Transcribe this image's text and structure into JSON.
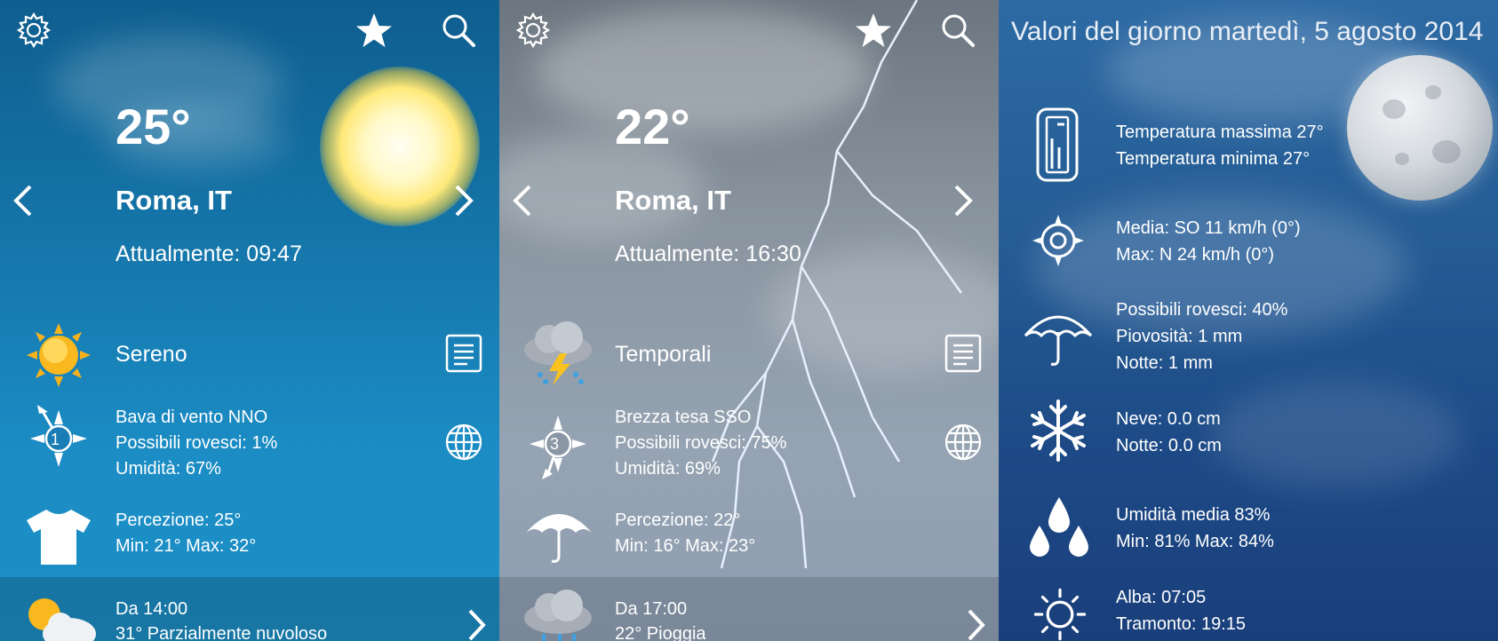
{
  "screen1": {
    "temperature": "25°",
    "city": "Roma, IT",
    "current_time": "Attualmente: 09:47",
    "condition": "Sereno",
    "wind_lines": [
      "Bava di vento NNO",
      "Possibili rovesci: 1%",
      "Umidità: 67%"
    ],
    "wind_force": "1",
    "feel_lines": [
      "Percezione: 25°",
      "Min: 21° Max: 32°"
    ],
    "forecast_lines": [
      "Da 14:00",
      "31° Parzialmente nuvoloso"
    ]
  },
  "screen2": {
    "temperature": "22°",
    "city": "Roma, IT",
    "current_time": "Attualmente: 16:30",
    "condition": "Temporali",
    "wind_lines": [
      "Brezza tesa SSO",
      "Possibili rovesci: 75%",
      "Umidità: 69%"
    ],
    "wind_force": "3",
    "feel_lines": [
      "Percezione: 22°",
      "Min: 16° Max: 23°"
    ],
    "forecast_lines": [
      "Da 17:00",
      "22° Pioggia"
    ]
  },
  "screen3": {
    "title": "Valori del giorno martedì, 5 agosto 2014",
    "temperature_lines": [
      "Temperatura massima 27°",
      "Temperatura minima 27°"
    ],
    "wind_lines": [
      "Media: SO 11 km/h (0°)",
      "Max: N 24 km/h (0°)"
    ],
    "rain_lines": [
      "Possibili rovesci: 40%",
      "Piovosità: 1 mm",
      "Notte: 1 mm"
    ],
    "snow_lines": [
      "Neve: 0.0 cm",
      "Notte: 0.0 cm"
    ],
    "humidity_lines": [
      "Umidità media 83%",
      "Min: 81% Max: 84%"
    ],
    "sun_lines": [
      "Alba: 07:05",
      "Tramonto: 19:15"
    ]
  },
  "icons": {
    "settings": "gear-icon",
    "favorite": "star-icon",
    "search": "search-icon",
    "prev": "chevron-left-icon",
    "next": "chevron-right-icon",
    "details": "document-icon",
    "map": "globe-icon",
    "wind": "compass-icon",
    "feel": "tshirt-icon",
    "umbrella": "umbrella-icon",
    "thermometer": "thermometer-icon",
    "snow": "snowflake-icon",
    "humidity": "drops-icon",
    "sunrise": "sun-outline-icon"
  }
}
